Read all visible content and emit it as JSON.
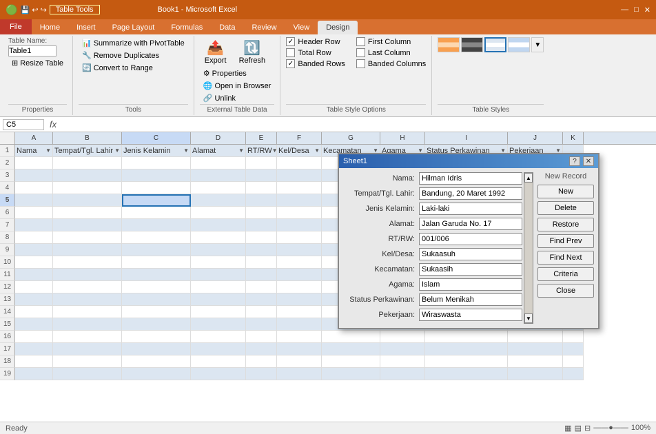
{
  "titleBar": {
    "leftIcons": "⊞ 💾 ↩",
    "title": "Book1 - Microsoft Excel",
    "tableToolsLabel": "Table Tools",
    "windowControls": [
      "—",
      "□",
      "×"
    ]
  },
  "tabs": [
    {
      "label": "File",
      "type": "file"
    },
    {
      "label": "Home"
    },
    {
      "label": "Insert"
    },
    {
      "label": "Page Layout"
    },
    {
      "label": "Formulas"
    },
    {
      "label": "Data"
    },
    {
      "label": "Review"
    },
    {
      "label": "View"
    },
    {
      "label": "Design",
      "active": true
    }
  ],
  "ribbon": {
    "groups": [
      {
        "label": "Properties",
        "items": [
          {
            "label": "Table Name:"
          },
          {
            "label": "Table1"
          },
          {
            "label": "Resize Table"
          }
        ]
      },
      {
        "label": "Tools",
        "items": [
          {
            "label": "Summarize with PivotTable"
          },
          {
            "label": "Remove Duplicates"
          },
          {
            "label": "Convert to Range"
          }
        ]
      },
      {
        "label": "External Table Data",
        "items": [
          {
            "label": "Export"
          },
          {
            "label": "Refresh"
          },
          {
            "label": "Properties"
          },
          {
            "label": "Open in Browser"
          },
          {
            "label": "Unlink"
          }
        ]
      },
      {
        "label": "Table Style Options",
        "checkboxes": [
          {
            "label": "Header Row",
            "checked": true
          },
          {
            "label": "Total Row",
            "checked": false
          },
          {
            "label": "Banded Rows",
            "checked": true
          },
          {
            "label": "First Column",
            "checked": false
          },
          {
            "label": "Last Column",
            "checked": false
          },
          {
            "label": "Banded Columns",
            "checked": false
          }
        ]
      },
      {
        "label": "Table Styles",
        "swatches": 6
      }
    ]
  },
  "formulaBar": {
    "cellRef": "C5",
    "fx": "fx",
    "formula": ""
  },
  "grid": {
    "colHeaders": [
      "",
      "A",
      "B",
      "C",
      "D",
      "E",
      "F",
      "G",
      "H",
      "I",
      "J",
      "K"
    ],
    "headerRow": {
      "cols": [
        "Nama",
        "Tempat/Tgl. Lahir",
        "Jenis Kelamin",
        "Alamat",
        "RT/RW",
        "Kel/Desa",
        "Kecamatan",
        "Agama",
        "Status Perkawinan",
        "Pekerjaan"
      ]
    },
    "rows": 18
  },
  "dialog": {
    "title": "Sheet1",
    "controls": [
      "?",
      "×"
    ],
    "fields": [
      {
        "label": "Nama:",
        "value": "Hilman Idris"
      },
      {
        "label": "Tempat/Tgl. Lahir:",
        "value": "Bandung, 20 Maret 1992"
      },
      {
        "label": "Jenis Kelamin:",
        "value": "Laki-laki"
      },
      {
        "label": "Alamat:",
        "value": "Jalan Garuda No. 17"
      },
      {
        "label": "RT/RW:",
        "value": "001/006"
      },
      {
        "label": "Kel/Desa:",
        "value": "Sukaasuh"
      },
      {
        "label": "Kecamatan:",
        "value": "Sukaasih"
      },
      {
        "label": "Agama:",
        "value": "Islam"
      },
      {
        "label": "Status Perkawinan:",
        "value": "Belum Menikah"
      },
      {
        "label": "Pekerjaan:",
        "value": "Wiraswasta"
      }
    ],
    "buttons": [
      {
        "label": "New Record"
      },
      {
        "label": "New"
      },
      {
        "label": "Delete"
      },
      {
        "label": "Restore"
      },
      {
        "label": "Find Prev"
      },
      {
        "label": "Find Next"
      },
      {
        "label": "Criteria"
      },
      {
        "label": "Close"
      }
    ]
  }
}
